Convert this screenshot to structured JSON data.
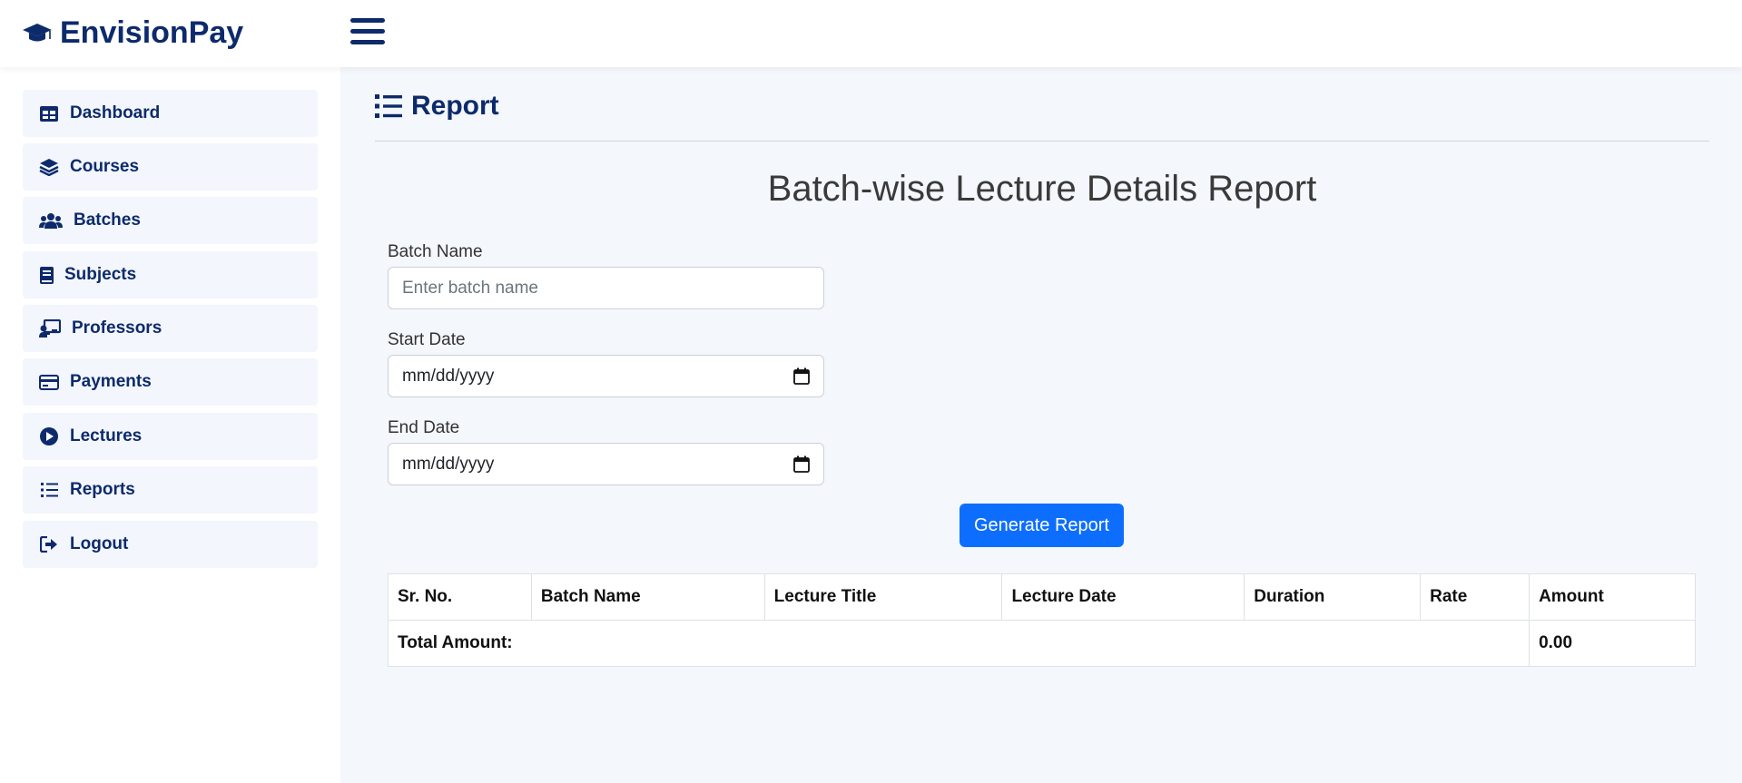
{
  "app": {
    "brand": "EnvisionPay",
    "brand_icon": "graduation-cap-icon",
    "accent_color": "#0d2b6b",
    "primary_button_color": "#0d6efd"
  },
  "sidebar": {
    "items": [
      {
        "label": "Dashboard",
        "icon": "table-icon"
      },
      {
        "label": "Courses",
        "icon": "layers-icon"
      },
      {
        "label": "Batches",
        "icon": "users-icon"
      },
      {
        "label": "Subjects",
        "icon": "book-icon"
      },
      {
        "label": "Professors",
        "icon": "chalkboard-teacher-icon"
      },
      {
        "label": "Payments",
        "icon": "credit-card-icon"
      },
      {
        "label": "Lectures",
        "icon": "play-circle-icon"
      },
      {
        "label": "Reports",
        "icon": "list-icon"
      },
      {
        "label": "Logout",
        "icon": "sign-out-icon"
      }
    ]
  },
  "page": {
    "title": "Report",
    "report_title": "Batch-wise Lecture Details Report"
  },
  "form": {
    "batch_name": {
      "label": "Batch Name",
      "placeholder": "Enter batch name"
    },
    "start_date": {
      "label": "Start Date",
      "value": "mm/dd/yyyy"
    },
    "end_date": {
      "label": "End Date",
      "value": "mm/dd/yyyy"
    },
    "generate_label": "Generate Report"
  },
  "table": {
    "columns": [
      "Sr. No.",
      "Batch Name",
      "Lecture Title",
      "Lecture Date",
      "Duration",
      "Rate",
      "Amount"
    ],
    "total_label": "Total Amount:",
    "total_value": "0.00"
  }
}
